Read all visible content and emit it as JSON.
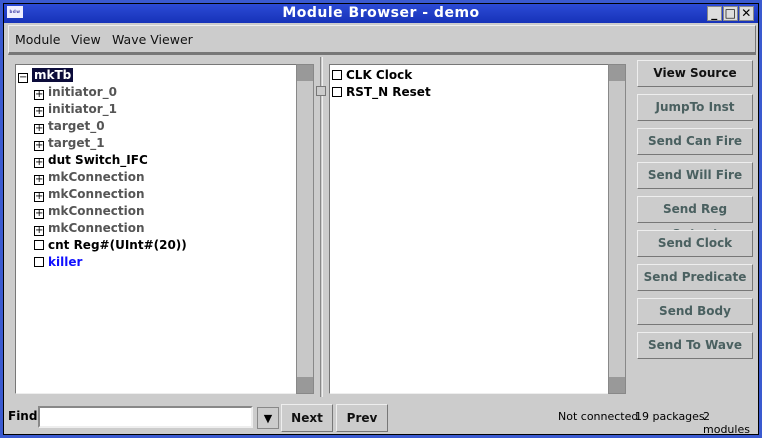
{
  "window": {
    "title": "Module Browser  - demo",
    "app_icon": "bdw"
  },
  "menu": [
    "Module",
    "View",
    "Wave Viewer"
  ],
  "tree": [
    {
      "label": "mkTb",
      "expander": "minus",
      "color": "#ffffff",
      "selected": true,
      "indent": 0
    },
    {
      "label": "initiator_0",
      "expander": "plus",
      "color": "#555555",
      "indent": 1
    },
    {
      "label": "initiator_1",
      "expander": "plus",
      "color": "#555555",
      "indent": 1
    },
    {
      "label": "target_0",
      "expander": "plus",
      "color": "#555555",
      "indent": 1
    },
    {
      "label": "target_1",
      "expander": "plus",
      "color": "#555555",
      "indent": 1
    },
    {
      "label": "dut  Switch_IFC",
      "expander": "plus",
      "color": "#000000",
      "indent": 1
    },
    {
      "label": "mkConnection",
      "expander": "plus",
      "color": "#555555",
      "indent": 1
    },
    {
      "label": "mkConnection",
      "expander": "plus",
      "color": "#555555",
      "indent": 1
    },
    {
      "label": "mkConnection",
      "expander": "plus",
      "color": "#555555",
      "indent": 1
    },
    {
      "label": "mkConnection",
      "expander": "plus",
      "color": "#555555",
      "indent": 1
    },
    {
      "label": "cnt  Reg#(UInt#(20))",
      "expander": "none",
      "color": "#000000",
      "indent": 1
    },
    {
      "label": "killer",
      "expander": "none",
      "color": "#1010ff",
      "indent": 1
    }
  ],
  "signals": [
    "CLK  Clock",
    "RST_N  Reset"
  ],
  "buttons": [
    "View Source",
    "JumpTo Inst",
    "Send Can Fire",
    "Send Will Fire",
    "Send Reg Output",
    "Send Clock",
    "Send Predicate",
    "Send Body",
    "Send To Wave"
  ],
  "find": {
    "label": "Find",
    "value": "",
    "next": "Next",
    "prev": "Prev"
  },
  "status": {
    "connection": "Not connected",
    "packages": "19 packages",
    "modules": "2 modules"
  }
}
